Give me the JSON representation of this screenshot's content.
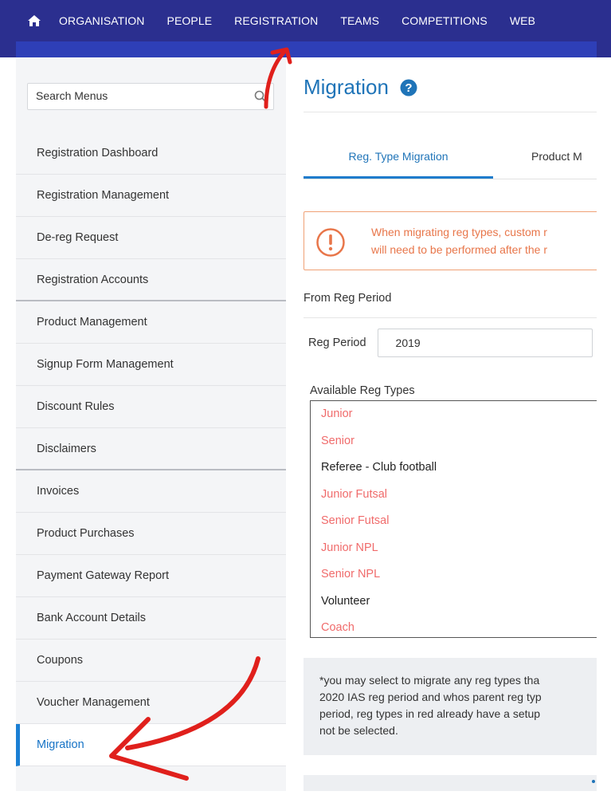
{
  "topnav": {
    "items": [
      "ORGANISATION",
      "PEOPLE",
      "REGISTRATION",
      "TEAMS",
      "COMPETITIONS",
      "WEB"
    ]
  },
  "sidebar": {
    "search_placeholder": "Search Menus",
    "items": [
      {
        "label": "Registration Dashboard"
      },
      {
        "label": "Registration Management"
      },
      {
        "label": "De-reg Request"
      },
      {
        "label": "Registration Accounts"
      },
      {
        "label": "Product Management"
      },
      {
        "label": "Signup Form Management"
      },
      {
        "label": "Discount Rules"
      },
      {
        "label": "Disclaimers"
      },
      {
        "label": "Invoices"
      },
      {
        "label": "Product Purchases"
      },
      {
        "label": "Payment Gateway Report"
      },
      {
        "label": "Bank Account Details"
      },
      {
        "label": "Coupons"
      },
      {
        "label": "Voucher Management"
      },
      {
        "label": "Migration"
      }
    ]
  },
  "main": {
    "title": "Migration",
    "tabs": {
      "active": "Reg. Type Migration",
      "other": "Product M"
    },
    "alert": {
      "line1": "When migrating reg types, custom r",
      "line2": "will need to be performed after the r"
    },
    "from_section": "From Reg Period",
    "reg_period_label": "Reg Period",
    "reg_period_value": "2019",
    "available_label": "Available Reg Types",
    "reg_types": [
      {
        "name": "Junior",
        "color": "red"
      },
      {
        "name": "Senior",
        "color": "red"
      },
      {
        "name": "Referee - Club football",
        "color": "dark"
      },
      {
        "name": "Junior Futsal",
        "color": "red"
      },
      {
        "name": "Senior Futsal",
        "color": "red"
      },
      {
        "name": "Junior NPL",
        "color": "red"
      },
      {
        "name": "Senior NPL",
        "color": "red"
      },
      {
        "name": "Volunteer",
        "color": "dark"
      },
      {
        "name": "Coach",
        "color": "red"
      }
    ],
    "note": {
      "line1": "*you may select to migrate any reg types tha",
      "line2": "2020 IAS reg period and whos parent reg typ",
      "line3": "period, reg types in red already have a setup",
      "line4": "not be selected."
    }
  },
  "colors": {
    "nav_bg": "#2b2f8f",
    "accent": "#1f74b8",
    "alert": "#e8764a",
    "red_option": "#f06b6b",
    "annotation": "#e0201c"
  }
}
